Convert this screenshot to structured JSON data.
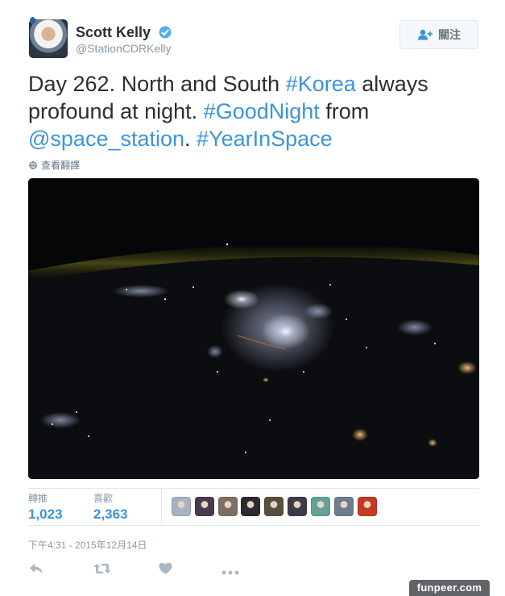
{
  "user": {
    "display_name": "Scott Kelly",
    "handle": "@StationCDRKelly",
    "verified_icon": "verified-badge-icon"
  },
  "follow_button": {
    "label": "關注",
    "icon": "add-user-icon"
  },
  "tweet": {
    "parts": [
      {
        "text": "Day 262. North and South ",
        "link": false
      },
      {
        "text": "#Korea",
        "link": true
      },
      {
        "text": " always profound at night. ",
        "link": false
      },
      {
        "text": "#GoodNight",
        "link": true
      },
      {
        "text": " from ",
        "link": false
      },
      {
        "text": "@space_station",
        "link": true
      },
      {
        "text": ". ",
        "link": false
      },
      {
        "text": "#YearInSpace",
        "link": true
      }
    ],
    "translate_label": "查看翻譯"
  },
  "stats": {
    "retweets_label": "轉推",
    "retweets_value": "1,023",
    "likes_label": "喜歡",
    "likes_value": "2,363"
  },
  "liker_avatars": [
    "#a7b3c0",
    "#4a3a4c",
    "#7c6f63",
    "#2f2a2e",
    "#5a4f3f",
    "#3d3b45",
    "#5fa39b",
    "#6c7d8e",
    "#c63a1f"
  ],
  "timestamp": "下午4:31 - 2015年12月14日",
  "actions": [
    "reply-icon",
    "retweet-icon",
    "like-icon",
    "more-icon"
  ],
  "colors": {
    "link": "#3b94d9",
    "text": "#292f33",
    "muted": "#8899a6",
    "verified": "#55acee"
  },
  "watermark": "funpeer.com"
}
